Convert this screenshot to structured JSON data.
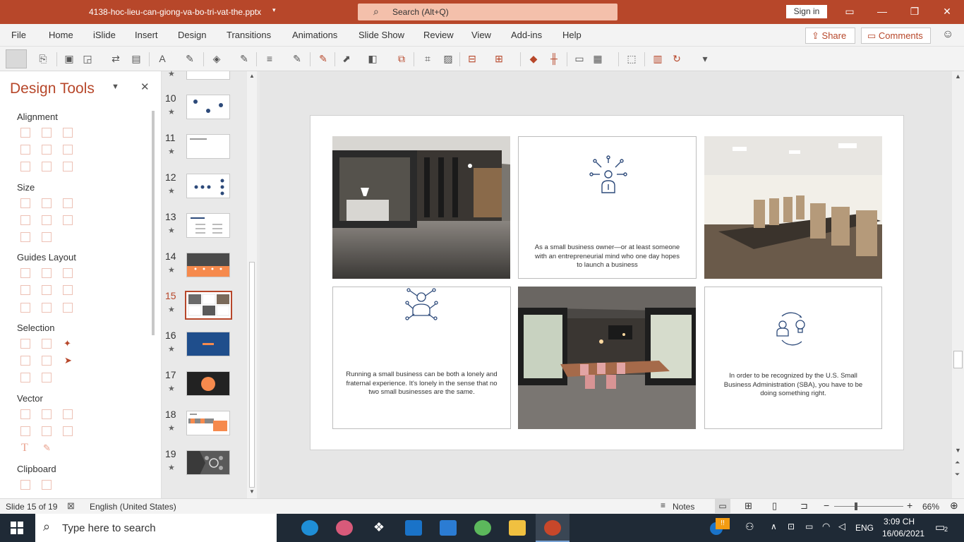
{
  "titlebar": {
    "document_name": "4138-hoc-lieu-can-giong-va-bo-tri-vat-the.pptx",
    "search_placeholder": "Search (Alt+Q)",
    "signin_label": "Sign in"
  },
  "menu": {
    "items": [
      "File",
      "Home",
      "iSlide",
      "Insert",
      "Design",
      "Transitions",
      "Animations",
      "Slide Show",
      "Review",
      "View",
      "Add-ins",
      "Help"
    ],
    "share_label": "Share",
    "comments_label": "Comments"
  },
  "design_tools": {
    "title": "Design Tools",
    "sections": [
      "Alignment",
      "Size",
      "Guides Layout",
      "Selection",
      "Vector",
      "Clipboard"
    ]
  },
  "thumbnails": {
    "numbers": [
      "10",
      "11",
      "12",
      "13",
      "14",
      "15",
      "16",
      "17",
      "18",
      "19"
    ],
    "selected": "15",
    "star": "★"
  },
  "slide": {
    "card1_text": "As a small business owner—or at least someone with an entrepreneurial mind who one day hopes to launch a business",
    "card2_text": "Running a small business can be both a lonely and fraternal experience. It's lonely in the sense that no two small businesses are the same.",
    "card3_text": "In order to be recognized by the U.S. Small Business Administration (SBA), you have to be doing something right."
  },
  "statusbar": {
    "slide_info": "Slide 15 of 19",
    "language": "English (United States)",
    "notes_label": "Notes",
    "zoom": "66%"
  },
  "taskbar": {
    "search_placeholder": "Type here to search",
    "language": "ENG",
    "time": "3:09 CH",
    "date": "16/06/2021",
    "notification_count": "2"
  },
  "colors": {
    "accent": "#b7472a",
    "icon_blue": "#2d4a7a",
    "orange": "#f68a4d"
  }
}
